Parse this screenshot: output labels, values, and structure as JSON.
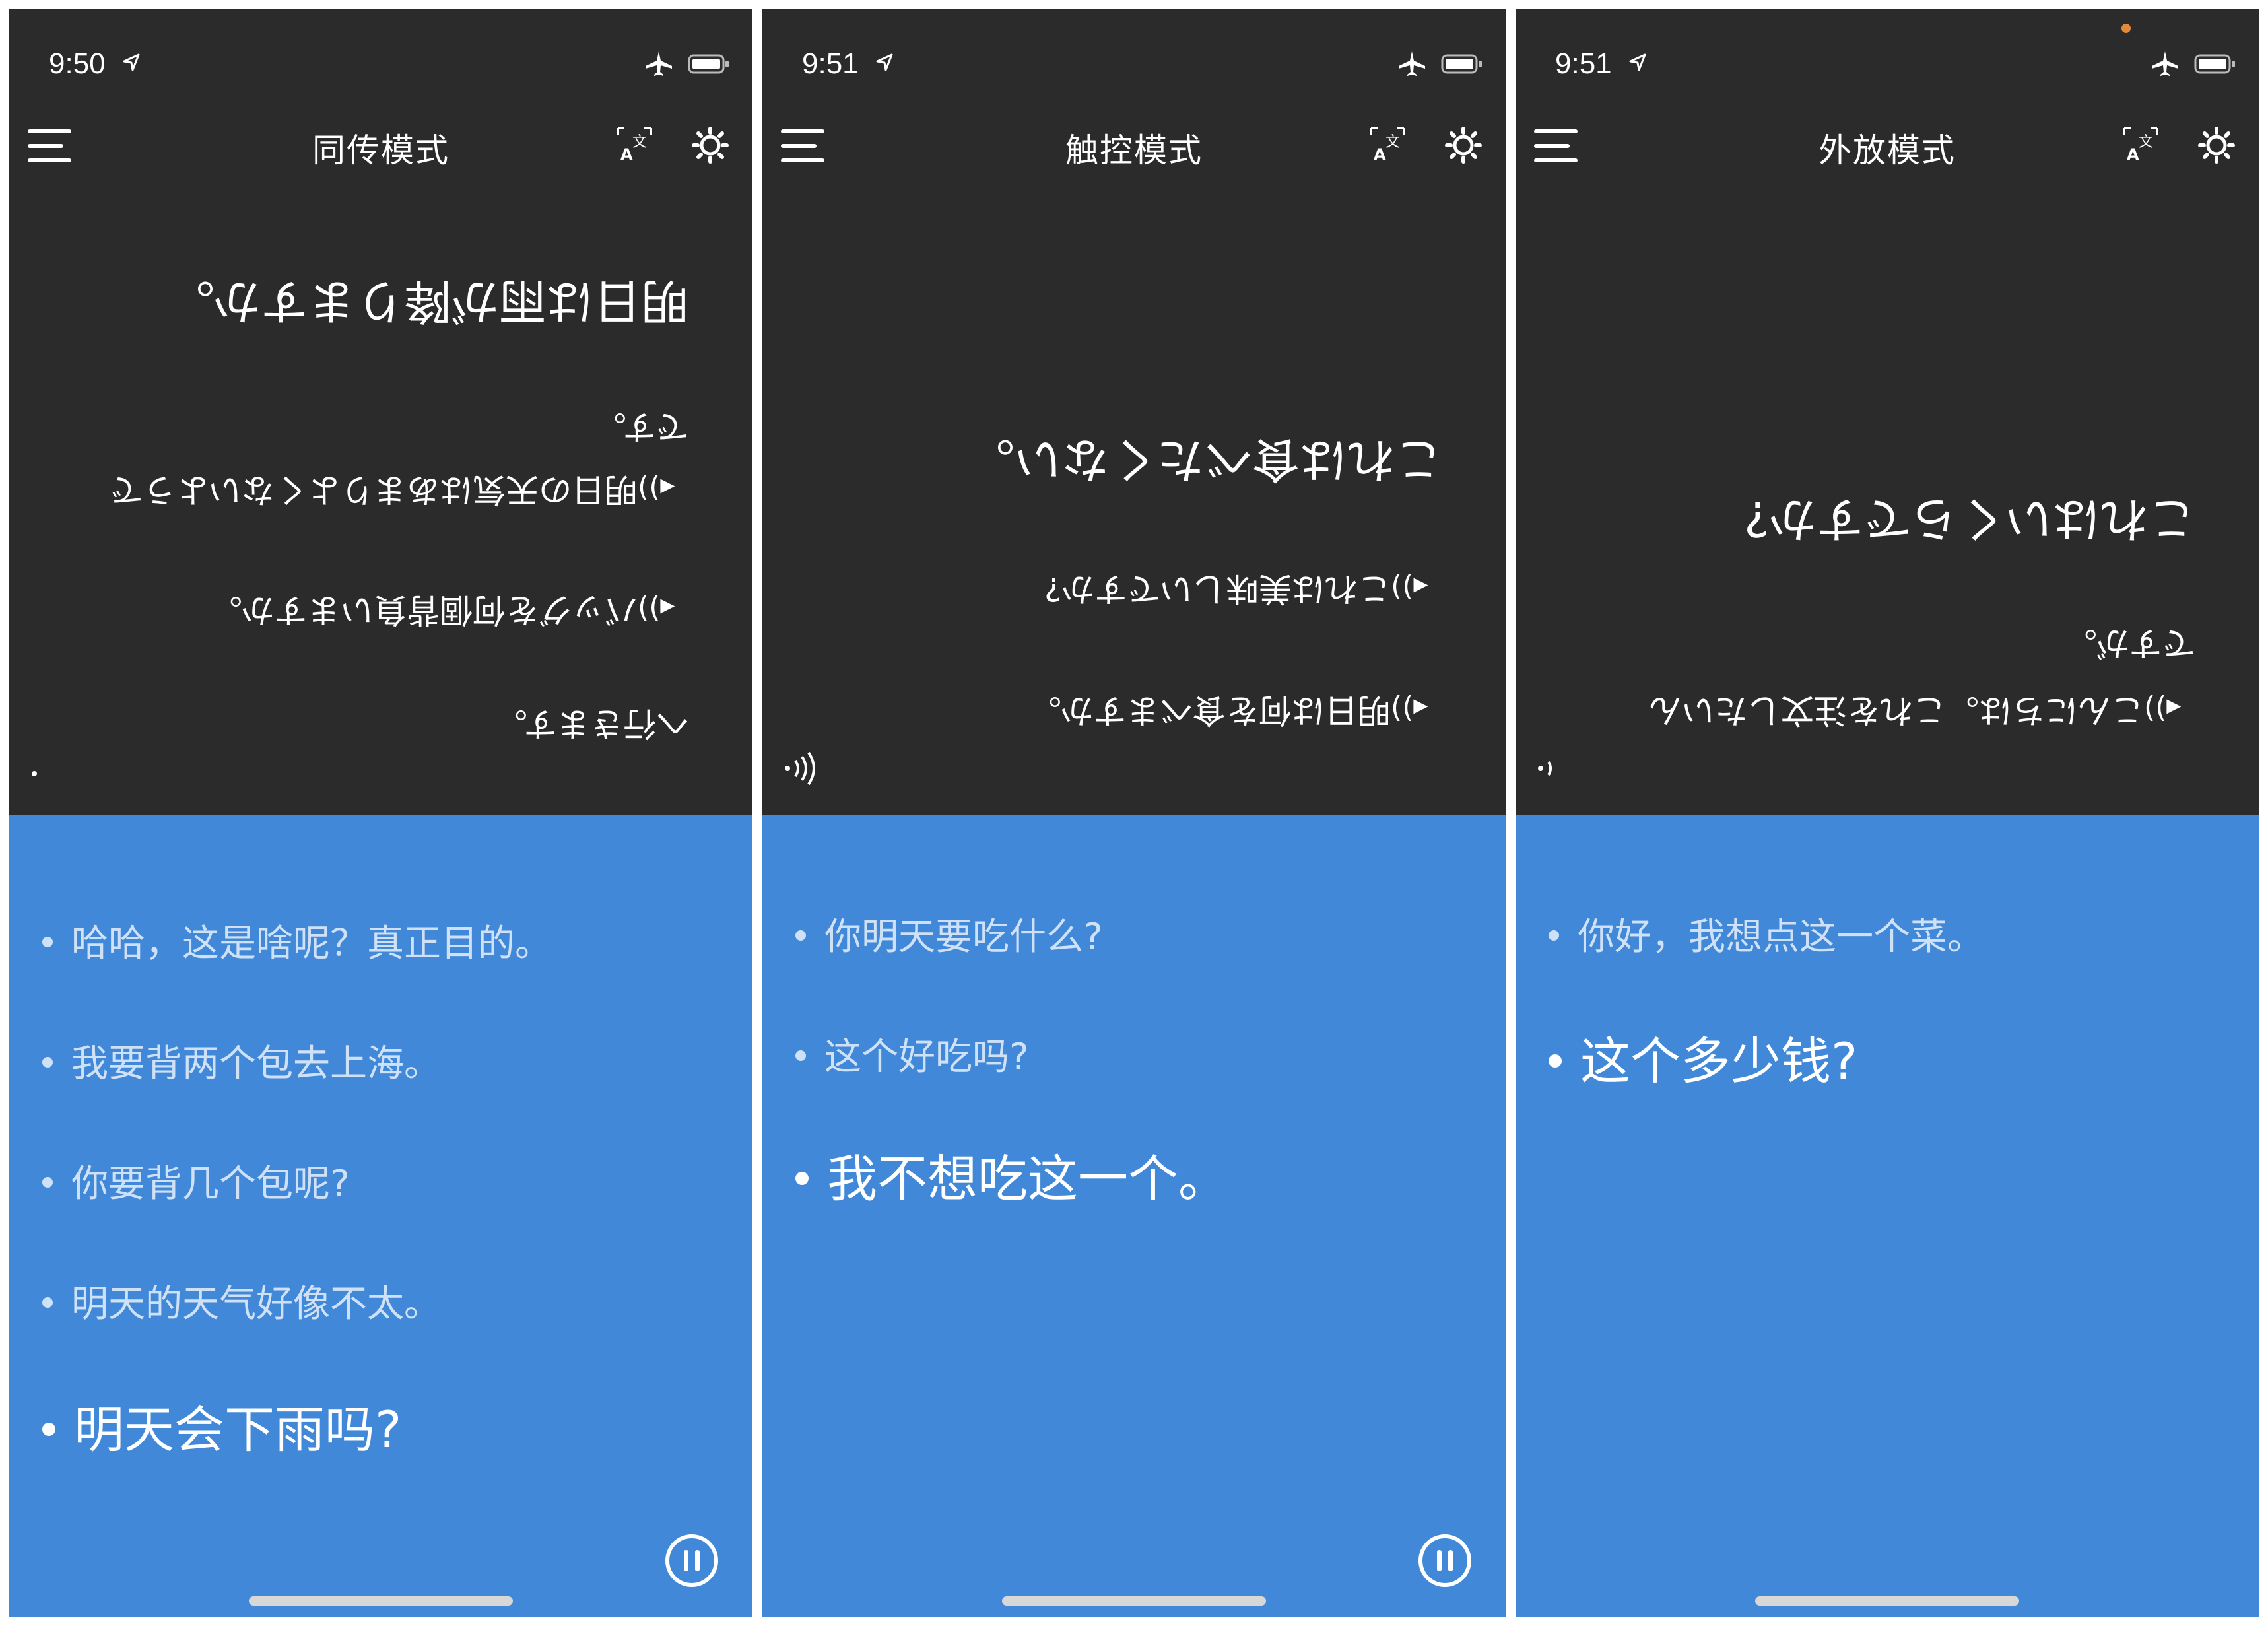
{
  "screens": [
    {
      "status": {
        "time": "9:50"
      },
      "header": {
        "title": "同传模式"
      },
      "japanese": [
        "明日は雨が降りますか。",
        "です。",
        "明日の天気はあまりよくないようで",
        "バッグを何個背負いますか。",
        "へ行きます。"
      ],
      "chinese": [
        "哈哈，这是啥呢？真正目的。",
        "我要背两个包去上海。",
        "你要背几个包呢?",
        "明天的天气好像不太。",
        "明天会下雨吗?"
      ]
    },
    {
      "status": {
        "time": "9:51"
      },
      "header": {
        "title": "触控模式"
      },
      "japanese": [
        "これは食べたくない。",
        "これは美味しいですか?",
        "明日は何を食べますか。"
      ],
      "chinese": [
        "你明天要吃什么?",
        "这个好吃吗?",
        "我不想吃这一个。"
      ]
    },
    {
      "status": {
        "time": "9:51"
      },
      "header": {
        "title": "外放模式"
      },
      "japanese": [
        "これはいくらですか?",
        "ですが。",
        "こんにちは。これを注文したいん"
      ],
      "chinese": [
        "你好，我想点这一个菜。",
        "这个多少钱?"
      ]
    }
  ],
  "icons": {
    "menu": "hamburger-menu-icon",
    "translate": "translate-icon",
    "settings": "gear-icon",
    "speaker": "speaker-icon",
    "pause": "pause-icon",
    "airplane": "airplane-mode-icon",
    "battery": "battery-icon",
    "location": "location-arrow-icon"
  },
  "colors": {
    "dark_bg": "#2b2b2b",
    "blue_bg": "#4188d8",
    "past_text": "#cfe1f6",
    "current_text": "#ffffff"
  }
}
